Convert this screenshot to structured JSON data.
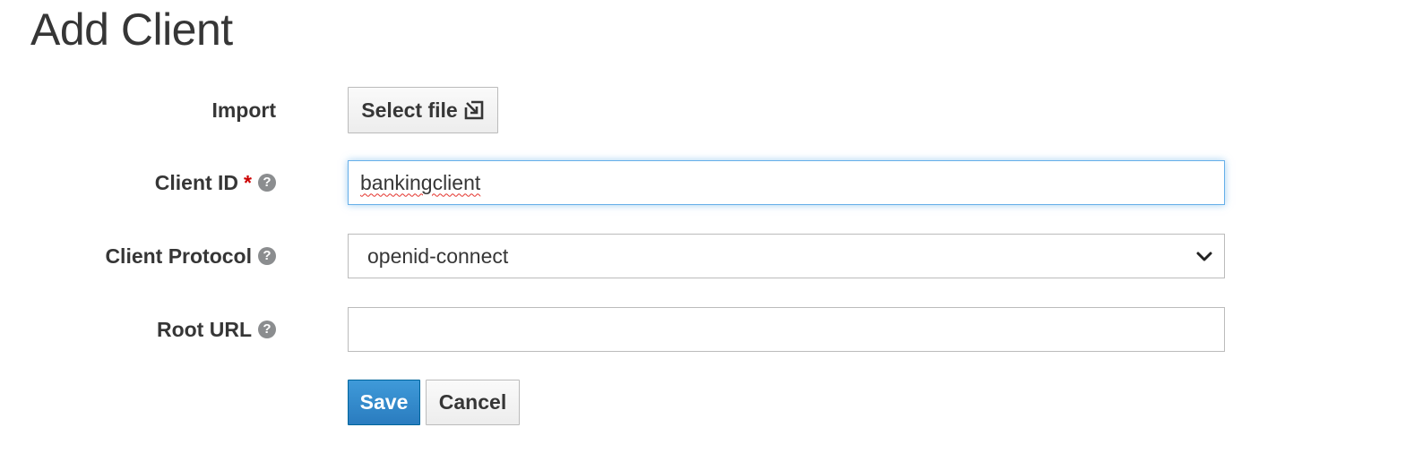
{
  "page": {
    "title": "Add Client"
  },
  "form": {
    "import": {
      "label": "Import",
      "button_label": "Select file"
    },
    "client_id": {
      "label": "Client ID",
      "required_marker": "*",
      "value": "bankingclient"
    },
    "client_protocol": {
      "label": "Client Protocol",
      "selected": "openid-connect"
    },
    "root_url": {
      "label": "Root URL",
      "value": ""
    },
    "help_icon_glyph": "?"
  },
  "actions": {
    "save_label": "Save",
    "cancel_label": "Cancel"
  },
  "colors": {
    "primary": "#2a7cbf",
    "required": "#cc0000",
    "focus_border": "#66afe9"
  }
}
